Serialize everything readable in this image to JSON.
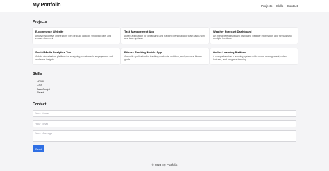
{
  "header": {
    "title": "My Portfolio",
    "nav": [
      "Projects",
      "Skills",
      "Contact"
    ]
  },
  "projects": {
    "heading": "Projects",
    "items": [
      {
        "title": "E-commerce Website",
        "desc": "A fully responsive online store with product catalog, shopping cart, and secure checkout."
      },
      {
        "title": "Task Management App",
        "desc": "A web application for organizing and tracking personal and team tasks with real-time updates."
      },
      {
        "title": "Weather Forecast Dashboard",
        "desc": "An interactive dashboard displaying weather information and forecasts for multiple locations."
      },
      {
        "title": "Social Media Analytics Tool",
        "desc": "A data visualization platform for analyzing social media engagement and audience insights."
      },
      {
        "title": "Fitness Tracking Mobile App",
        "desc": "A mobile application for tracking workouts, nutrition, and personal fitness goals."
      },
      {
        "title": "Online Learning Platform",
        "desc": "A comprehensive e-learning system with course management, video lectures, and progress tracking."
      }
    ]
  },
  "skills": {
    "heading": "Skills",
    "items": [
      "HTML",
      "CSS",
      "JavaScript",
      "React"
    ]
  },
  "contact": {
    "heading": "Contact",
    "name_placeholder": "Your Name",
    "email_placeholder": "Your Email",
    "message_placeholder": "Your Message",
    "send_label": "Send"
  },
  "footer": {
    "text": "© 2024 My Portfolio"
  },
  "colors": {
    "accent": "#2f6fe4",
    "background": "#f4f4f6"
  }
}
